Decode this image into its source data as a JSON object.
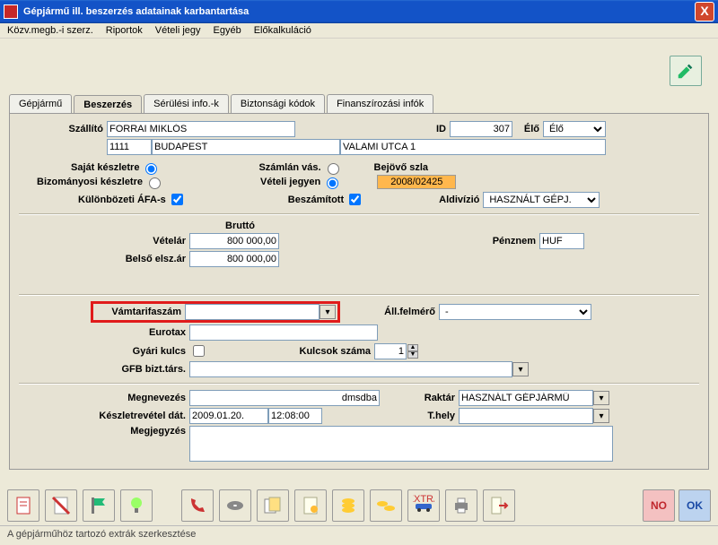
{
  "window": {
    "title": "Gépjármű ill. beszerzés adatainak karbantartása",
    "close": "X"
  },
  "menu": {
    "items": [
      "Közv.megb.-i szerz.",
      "Riportok",
      "Vételi jegy",
      "Egyéb",
      "Előkalkuláció"
    ]
  },
  "tabs": {
    "items": [
      "Gépjármű",
      "Beszerzés",
      "Sérülési info.-k",
      "Biztonsági kódok",
      "Finanszírozási infók"
    ],
    "active": 1
  },
  "form": {
    "szallito_lbl": "Szállító",
    "szallito_nev": "FORRAI MIKLÓS",
    "id_lbl": "ID",
    "id_val": "307",
    "elo_lbl": "Élő",
    "elo_val": "Élő",
    "irsz": "1111",
    "varos": "BUDAPEST",
    "cim": "VALAMI UTCA 1",
    "sajat_keszletre": "Saját készletre",
    "bizomanyosi": "Bizományosi készletre",
    "szamlan_vas": "Számlán vás.",
    "veteli_jegyen": "Vételi jegyen",
    "bejovo_szla": "Bejövő szla",
    "bejovo_szla_val": "2008/02425",
    "kulonbozeti": "Különbözeti ÁFA-s",
    "beszamitott": "Beszámított",
    "aldivizio_lbl": "Aldivízió",
    "aldivizio_val": "HASZNÁLT GÉPJ.",
    "brutto": "Bruttó",
    "vetelar_lbl": "Vételár",
    "vetelar_val": "800 000,00",
    "belso_lbl": "Belső elsz.ár",
    "belso_val": "800 000,00",
    "penznem_lbl": "Pénznem",
    "penznem_val": "HUF",
    "vamtarifa_lbl": "Vámtarifaszám",
    "vamtarifa_val": "",
    "all_felmero_lbl": "Áll.felmérő",
    "all_felmero_val": "-",
    "eurotax_lbl": "Eurotax",
    "eurotax_val": "",
    "gyari_kulcs_lbl": "Gyári kulcs",
    "kulcsok_szama_lbl": "Kulcsok száma",
    "kulcsok_szama_val": "1",
    "gfb_lbl": "GFB bizt.társ.",
    "gfb_val": "",
    "megnevezes_lbl": "Megnevezés",
    "megnevezes_val": "dmsdba",
    "raktar_lbl": "Raktár",
    "raktar_val": "HASZNÁLT GÉPJÁRMŰ",
    "keszletrevetel_lbl": "Készletrevétel dát.",
    "keszletrevetel_date": "2009.01.20.",
    "keszletrevetel_time": "12:08:00",
    "thely_lbl": "T.hely",
    "thely_val": "",
    "megjegyzes_lbl": "Megjegyzés",
    "megjegyzes_val": ""
  },
  "toolbar": {
    "buttons": [
      "doc",
      "nodoc",
      "flag",
      "bulb",
      "phone",
      "disc",
      "notes",
      "cert",
      "stack1",
      "stack2",
      "car-extra",
      "print",
      "exit"
    ],
    "no": "NO",
    "ok": "OK"
  },
  "status": "A gépjárműhöz tartozó extrák szerkesztése"
}
